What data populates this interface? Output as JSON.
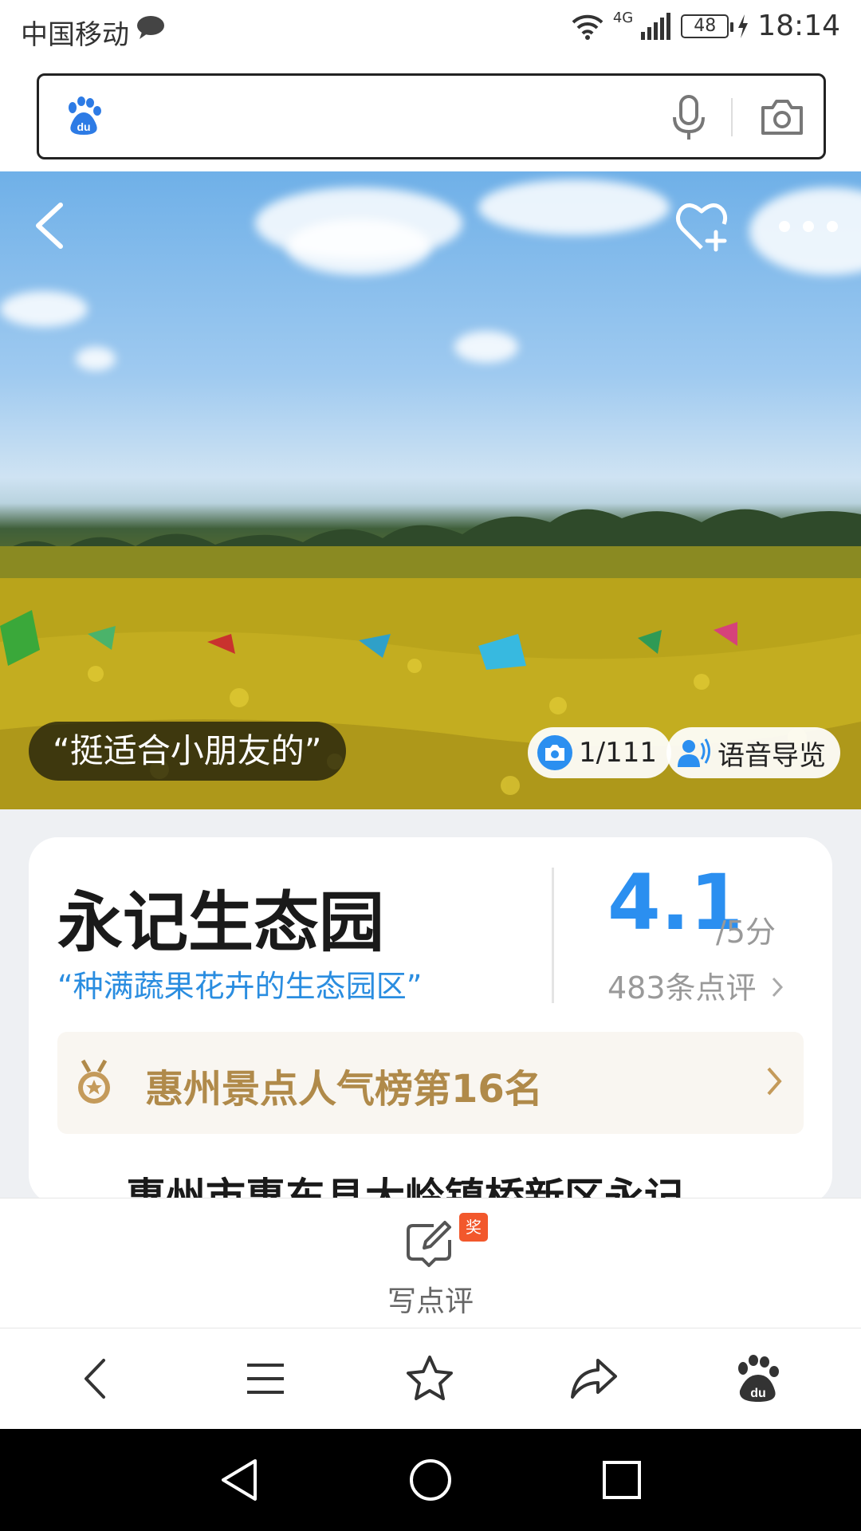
{
  "status_bar": {
    "carrier": "中国移动",
    "network": "4G",
    "battery": "48",
    "time": "18:14"
  },
  "search": {
    "placeholder": "",
    "icons": [
      "baidu-paw-icon",
      "microphone-icon",
      "camera-icon"
    ]
  },
  "hero": {
    "quote": "“挺适合小朋友的”",
    "photo_counter": "1/111",
    "audio_guide_label": "语音导览",
    "icons": [
      "back-arrow-icon",
      "heart-plus-icon",
      "more-dots-icon",
      "camera-icon",
      "audio-guide-icon"
    ]
  },
  "place": {
    "name": "永记生态园",
    "tagline": "“种满蔬果花卉的生态园区”",
    "score": "4.1",
    "score_unit": "/5分",
    "review_count": "483条点评",
    "ranking": "惠州景点人气榜第16名",
    "address_partial": "惠州市惠东县大岭镇桥新区永记"
  },
  "review_action": {
    "label": "写点评",
    "badge": "奖"
  },
  "toolbar": {
    "items": [
      "back",
      "menu",
      "favorite",
      "share",
      "baidu-home"
    ]
  },
  "colors": {
    "accent_blue": "#2b8ff0",
    "rank_gold": "#b08a4a",
    "award_orange": "#f2582c"
  }
}
